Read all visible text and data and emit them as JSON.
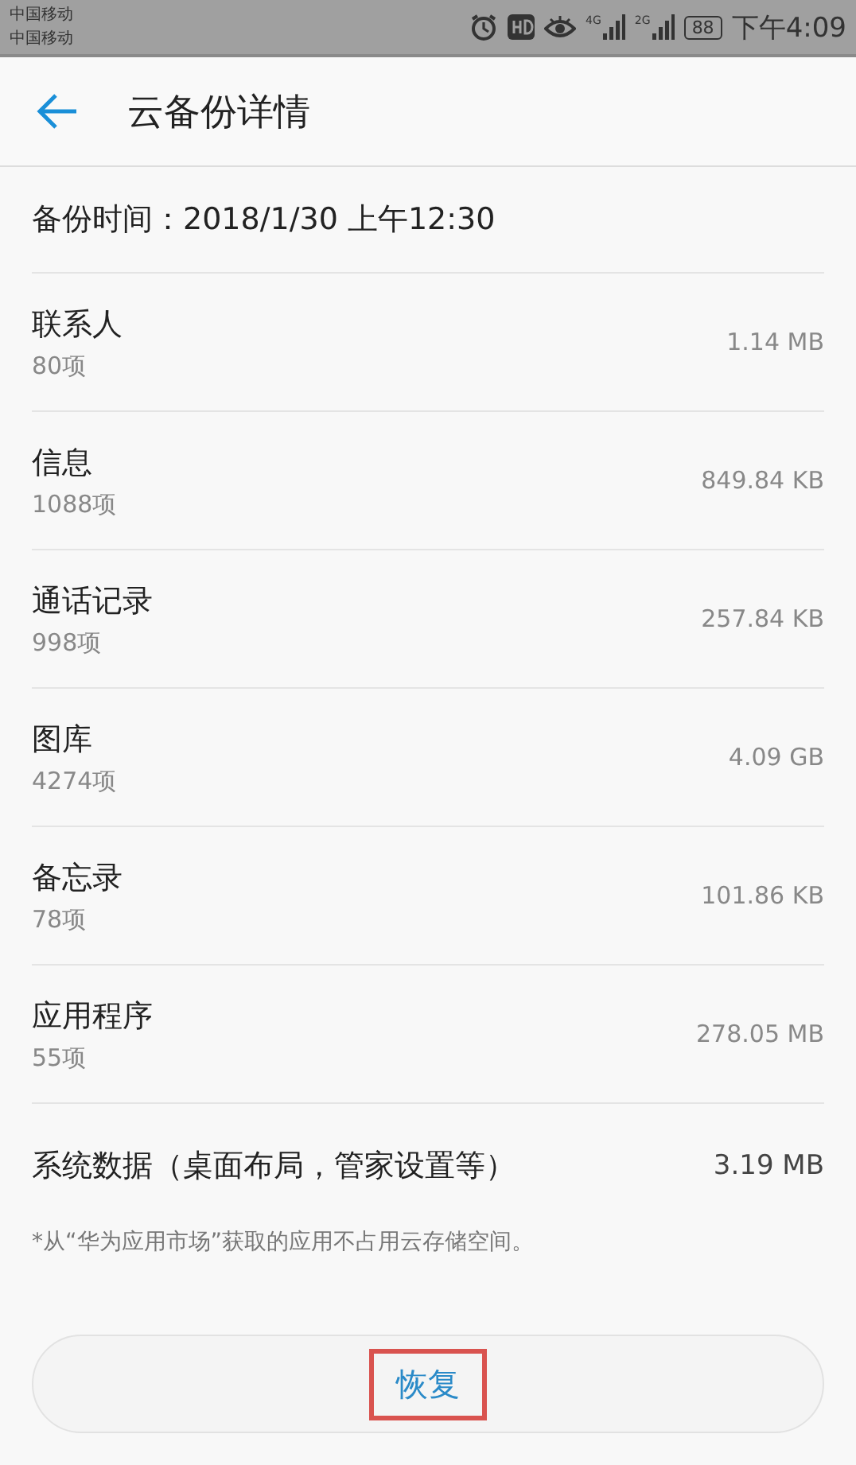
{
  "status_bar": {
    "carriers": [
      "中国移动",
      "中国移动"
    ],
    "network_1": "4G",
    "network_2": "2G",
    "battery": "88",
    "time": "下午4:09"
  },
  "header": {
    "title": "云备份详情"
  },
  "backup_time": "备份时间：2018/1/30 上午12:30",
  "items": [
    {
      "kind": "two_line",
      "name": "联系人",
      "count": "80项",
      "size": "1.14 MB"
    },
    {
      "kind": "two_line",
      "name": "信息",
      "count": "1088项",
      "size": "849.84 KB"
    },
    {
      "kind": "two_line",
      "name": "通话记录",
      "count": "998项",
      "size": "257.84 KB"
    },
    {
      "kind": "two_line",
      "name": "图库",
      "count": "4274项",
      "size": "4.09 GB"
    },
    {
      "kind": "two_line",
      "name": "备忘录",
      "count": "78项",
      "size": "101.86 KB"
    },
    {
      "kind": "two_line",
      "name": "应用程序",
      "count": "55项",
      "size": "278.05 MB"
    },
    {
      "kind": "single",
      "name": "系统数据（桌面布局，管家设置等）",
      "size": "3.19 MB"
    }
  ],
  "note": "*从“华为应用市场”获取的应用不占用云存储空间。",
  "restore_button": {
    "label": "恢复",
    "highlighted": true
  }
}
